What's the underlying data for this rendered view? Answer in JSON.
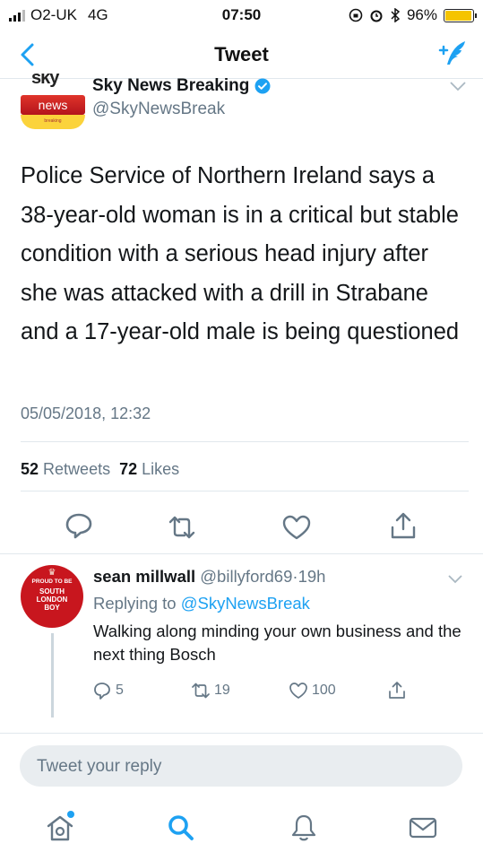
{
  "status_bar": {
    "carrier": "O2-UK",
    "network": "4G",
    "time": "07:50",
    "battery": "96%",
    "battery_level": 0.96
  },
  "nav": {
    "title": "Tweet",
    "back_icon": "chevron-left-icon",
    "compose_icon": "compose-tweet-icon"
  },
  "tweet": {
    "author_name": "Sky News Breaking",
    "author_handle": "@SkyNewsBreak",
    "logo_top": "sky",
    "logo_middle": "news",
    "logo_bottom": "breaking",
    "text": "Police Service of Northern Ireland says a 38-year-old woman is in a critical but stable condition with a serious head injury after she was attacked with a drill in Strabane and a 17-year-old male is being questioned",
    "timestamp": "05/05/2018, 12:32",
    "retweets_count": "52",
    "retweets_label": "Retweets",
    "likes_count": "72",
    "likes_label": "Likes"
  },
  "reply": {
    "name": "sean millwall",
    "handle": "@billyford69",
    "separator": "·",
    "time": "19h",
    "replying_prefix": "Replying to",
    "replying_to": "@SkyNewsBreak",
    "text": "Walking along minding your own business and the next thing Bosch",
    "avatar_line1": "PROUD TO BE",
    "avatar_line2": "SOUTH",
    "avatar_line3": "LONDON",
    "avatar_line4": "BOY",
    "replies": "5",
    "retweets": "19",
    "likes": "100"
  },
  "composer": {
    "placeholder": "Tweet your reply"
  },
  "tabbar": {
    "items": [
      "home-icon",
      "search-icon",
      "notifications-icon",
      "messages-icon"
    ]
  },
  "colors": {
    "accent": "#1da1f2",
    "text": "#14171a",
    "muted": "#657786",
    "divider": "#e1e8ed",
    "battery": "#f5c400"
  }
}
